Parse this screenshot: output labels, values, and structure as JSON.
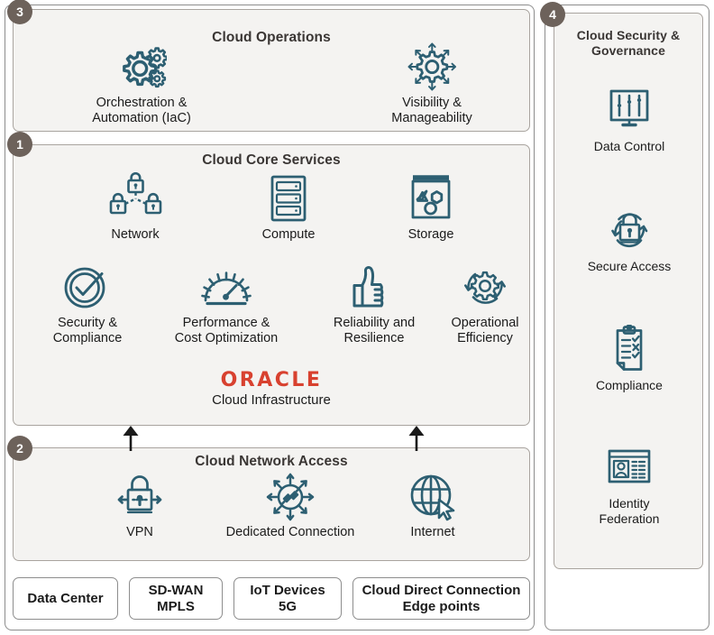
{
  "diagram": {
    "title": "Oracle Cloud Infrastructure reference architecture",
    "accent_teal": "#2d5f72",
    "badge_color": "#6d625b",
    "panel_background": "#f4f3f1",
    "oracle_red": "#d8412f"
  },
  "panels": {
    "operations": {
      "badge": "3",
      "title": "Cloud Operations",
      "items": [
        {
          "icon": "gears-icon",
          "label": "Orchestration &\nAutomation (IaC)"
        },
        {
          "icon": "gear-arrows-icon",
          "label": "Visibility &\nManageability"
        }
      ]
    },
    "core": {
      "badge": "1",
      "title": "Cloud Core Services",
      "row1": [
        {
          "icon": "network-locks-icon",
          "label": "Network"
        },
        {
          "icon": "server-rack-icon",
          "label": "Compute"
        },
        {
          "icon": "storage-shapes-icon",
          "label": "Storage"
        }
      ],
      "row2": [
        {
          "icon": "check-shield-circle-icon",
          "label": "Security &\nCompliance"
        },
        {
          "icon": "speedometer-icon",
          "label": "Performance &\nCost Optimization"
        },
        {
          "icon": "thumbs-up-icon",
          "label": "Reliability and\nResilience"
        },
        {
          "icon": "gear-refresh-icon",
          "label": "Operational\nEfficiency"
        }
      ],
      "brand": {
        "wordmark": "ORACLE",
        "subtitle": "Cloud Infrastructure"
      }
    },
    "network_access": {
      "badge": "2",
      "title": "Cloud Network Access",
      "items": [
        {
          "icon": "vpn-lock-icon",
          "label": "VPN"
        },
        {
          "icon": "dedicated-connection-icon",
          "label": "Dedicated Connection"
        },
        {
          "icon": "globe-cursor-icon",
          "label": "Internet"
        }
      ]
    },
    "security": {
      "badge": "4",
      "title": "Cloud Security &\nGovernance",
      "items": [
        {
          "icon": "monitor-sliders-icon",
          "label": "Data Control"
        },
        {
          "icon": "lock-refresh-icon",
          "label": "Secure Access"
        },
        {
          "icon": "clipboard-check-icon",
          "label": "Compliance"
        },
        {
          "icon": "id-card-icon",
          "label": "Identity\nFederation"
        }
      ]
    }
  },
  "sources": [
    {
      "label": "Data Center"
    },
    {
      "label": "SD-WAN\nMPLS"
    },
    {
      "label": "IoT Devices\n5G"
    },
    {
      "label": "Cloud Direct Connection\nEdge points"
    }
  ]
}
